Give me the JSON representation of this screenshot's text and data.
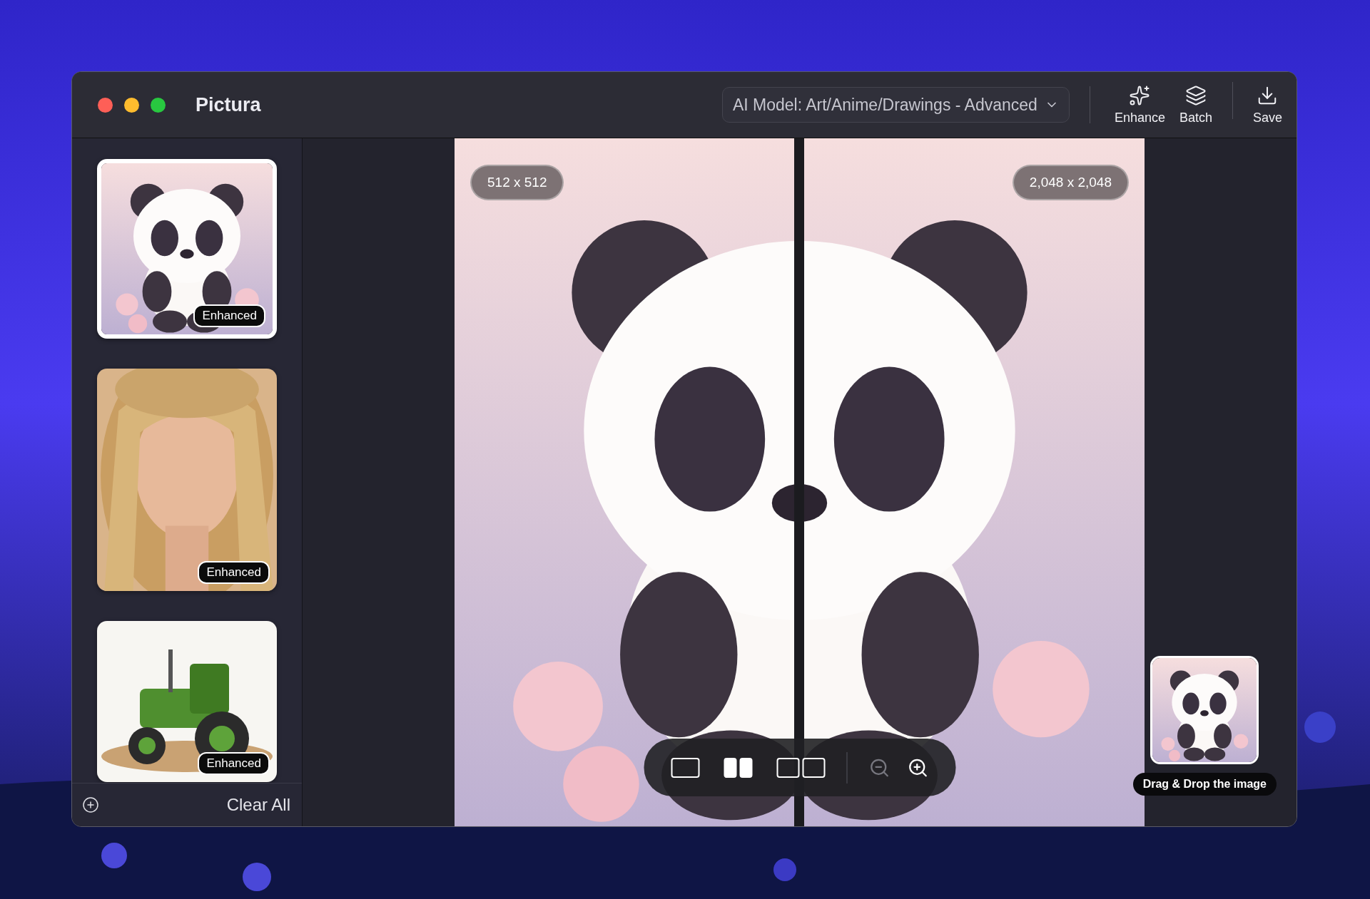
{
  "window": {
    "title": "Pictura"
  },
  "toolbar": {
    "model_select": {
      "label": "AI Model: Art/Anime/Drawings - Advanced"
    },
    "actions": [
      {
        "kind": "enhance",
        "label": "Enhance"
      },
      {
        "kind": "batch",
        "label": "Batch"
      },
      {
        "kind": "save",
        "label": "Save"
      }
    ]
  },
  "sidebar": {
    "items": [
      {
        "badge": "Enhanced",
        "selected": true
      },
      {
        "badge": "Enhanced",
        "selected": false
      },
      {
        "badge": "Enhanced",
        "selected": false
      }
    ],
    "clear_label": "Clear All"
  },
  "canvas": {
    "before_size": "512 x 512",
    "after_size": "2,048 x 2,048",
    "view_modes": [
      {
        "kind": "single",
        "selected": false
      },
      {
        "kind": "split",
        "selected": true
      },
      {
        "kind": "side_by_side",
        "selected": false
      }
    ],
    "zoom": [
      {
        "kind": "out",
        "disabled": true
      },
      {
        "kind": "in",
        "disabled": false
      }
    ]
  },
  "drop_target": {
    "label": "Drag & Drop the image"
  }
}
